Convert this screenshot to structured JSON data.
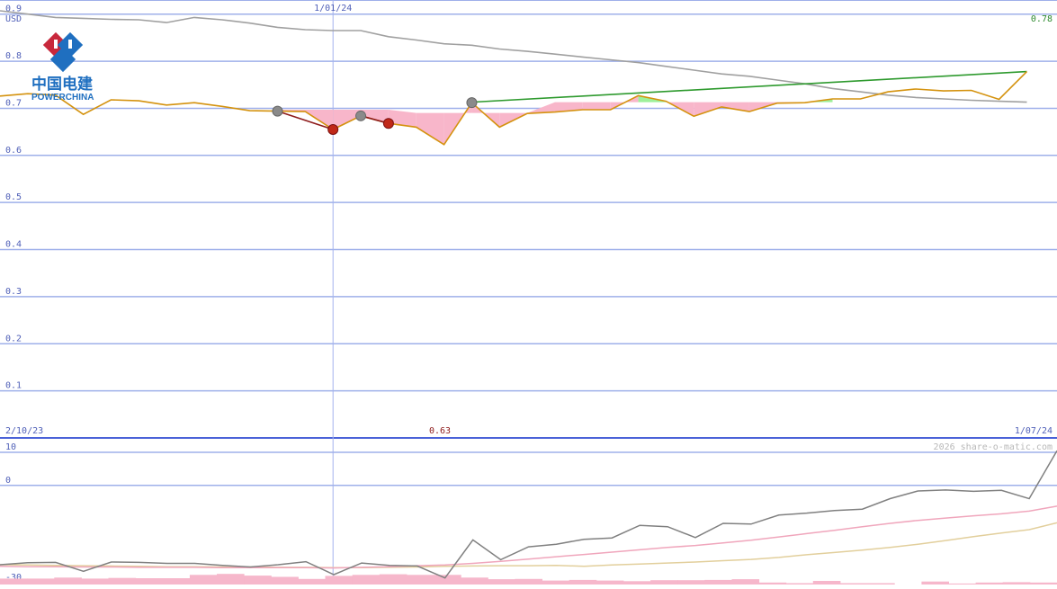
{
  "brand": {
    "name_cn": "中国电建",
    "name_en": "POWERCHINA",
    "colors": {
      "red": "#c8283c",
      "blue": "#1f6fc0"
    }
  },
  "chart_data": [
    {
      "type": "line",
      "panel": "price",
      "currency": "USD",
      "ylim": [
        0,
        0.93
      ],
      "yticks": [
        0.1,
        0.2,
        0.3,
        0.4,
        0.5,
        0.6,
        0.7,
        0.8,
        0.9
      ],
      "ytick_labels": [
        "0.1",
        "0.2",
        "0.3",
        "0.4",
        "0.5",
        "0.6",
        "0.7",
        "0.8",
        "0.9"
      ],
      "x_count": 36,
      "marker_label": "1/01/24",
      "marker_index": 12,
      "start_label": "2/10/23",
      "end_label": "1/07/24",
      "last_value_label": "0.78",
      "low_value_label": "0.63",
      "grid": true,
      "series": [
        {
          "role": "price",
          "color": "#d4920e",
          "values": [
            0.726,
            0.731,
            0.728,
            0.687,
            0.718,
            0.716,
            0.707,
            0.712,
            0.704,
            0.695,
            0.694,
            0.693,
            0.655,
            0.684,
            0.668,
            0.66,
            0.623,
            0.712,
            0.66,
            0.689,
            0.692,
            0.697,
            0.697,
            0.727,
            0.715,
            0.683,
            0.703,
            0.693,
            0.711,
            0.712,
            0.72,
            0.72,
            0.735,
            0.741,
            0.737,
            0.738,
            0.719,
            0.778
          ]
        },
        {
          "role": "long-moving-average",
          "color": "#a0a0a0",
          "values": [
            0.907,
            0.9,
            0.893,
            0.891,
            0.889,
            0.888,
            0.882,
            0.893,
            0.888,
            0.881,
            0.872,
            0.867,
            0.865,
            0.865,
            0.852,
            0.845,
            0.837,
            0.834,
            0.826,
            0.821,
            0.815,
            0.809,
            0.803,
            0.797,
            0.789,
            0.781,
            0.773,
            0.768,
            0.76,
            0.752,
            0.742,
            0.735,
            0.728,
            0.723,
            0.72,
            0.717,
            0.715,
            0.713
          ]
        },
        {
          "role": "reference-line",
          "color": "#2e9a2e",
          "values": [
            0.713,
            0.778
          ]
        }
      ],
      "trendline_indices": [
        17,
        37
      ],
      "band_baseline": [
        0.697,
        0.697,
        0.697,
        0.697,
        0.697,
        0.69,
        0.69,
        0.69,
        0.69,
        0.69,
        0.713,
        0.713,
        0.713,
        0.713,
        0.713,
        0.713,
        0.713,
        0.713,
        0.713,
        0.713,
        0.713
      ],
      "band_start_index": 10,
      "markers": [
        {
          "index": 10,
          "value": 0.694,
          "kind": "grey"
        },
        {
          "index": 12,
          "value": 0.655,
          "kind": "red"
        },
        {
          "index": 13,
          "value": 0.684,
          "kind": "grey"
        },
        {
          "index": 14,
          "value": 0.668,
          "kind": "red"
        },
        {
          "index": 17,
          "value": 0.712,
          "kind": "grey"
        }
      ]
    },
    {
      "type": "line",
      "panel": "momentum",
      "ylim": [
        -30,
        13
      ],
      "yticks": [
        10,
        0,
        -30
      ],
      "ytick_labels": [
        "10",
        "0",
        "-30"
      ],
      "copyright": "2026 share-o-matic.com",
      "series": [
        {
          "role": "oscillator",
          "color": "#808080",
          "values": [
            -24.0,
            -23.4,
            -23.3,
            -26.0,
            -23.2,
            -23.3,
            -23.6,
            -23.6,
            -24.2,
            -24.7,
            -24.0,
            -23.1,
            -27.0,
            -23.5,
            -24.2,
            -24.4,
            -28.0,
            -16.5,
            -22.5,
            -18.6,
            -17.8,
            -16.3,
            -15.9,
            -12.1,
            -12.5,
            -15.8,
            -11.5,
            -11.7,
            -9.0,
            -8.4,
            -7.6,
            -7.2,
            -4.0,
            -1.7,
            -1.4,
            -1.8,
            -1.5,
            -4.0,
            10.5
          ]
        },
        {
          "role": "signal-fast",
          "color": "#f0a6bc",
          "values": [
            -24.5,
            -24.6,
            -24.6,
            -24.7,
            -24.7,
            -24.8,
            -24.8,
            -24.8,
            -24.9,
            -24.9,
            -24.9,
            -24.9,
            -25.0,
            -24.8,
            -24.6,
            -24.3,
            -24.1,
            -23.6,
            -23.0,
            -22.3,
            -21.6,
            -20.9,
            -20.2,
            -19.5,
            -18.8,
            -18.2,
            -17.4,
            -16.6,
            -15.6,
            -14.6,
            -13.6,
            -12.5,
            -11.5,
            -10.6,
            -9.9,
            -9.2,
            -8.6,
            -7.8,
            -6.3
          ]
        },
        {
          "role": "signal-slow",
          "color": "#e2cf9c",
          "values": [
            -24.0,
            -24.1,
            -24.2,
            -24.3,
            -24.4,
            -24.5,
            -24.6,
            -24.6,
            -24.7,
            -24.7,
            -24.8,
            -24.8,
            -24.9,
            -24.9,
            -24.8,
            -24.7,
            -24.5,
            -24.4,
            -24.3,
            -24.3,
            -24.2,
            -24.5,
            -24.1,
            -23.8,
            -23.5,
            -23.2,
            -22.8,
            -22.4,
            -21.8,
            -21.0,
            -20.3,
            -19.6,
            -18.8,
            -17.8,
            -16.7,
            -15.5,
            -14.4,
            -13.4,
            -11.3
          ]
        }
      ],
      "histogram": [
        -28.2,
        -28.2,
        -27.9,
        -28.2,
        -28.0,
        -28.1,
        -28.1,
        -27.1,
        -26.8,
        -27.3,
        -27.7,
        -28.3,
        -27.4,
        -27.1,
        -26.9,
        -27.1,
        -27.1,
        -27.9,
        -28.4,
        -28.3,
        -28.8,
        -28.6,
        -28.8,
        -29.0,
        -28.7,
        -28.7,
        -28.6,
        -28.4,
        -29.4,
        -29.6,
        -28.9,
        -29.6,
        -29.6,
        -30.0,
        -29.1,
        -29.7,
        -29.4,
        -29.3,
        -29.4
      ],
      "histogram_color": "#f6b7cb"
    }
  ]
}
